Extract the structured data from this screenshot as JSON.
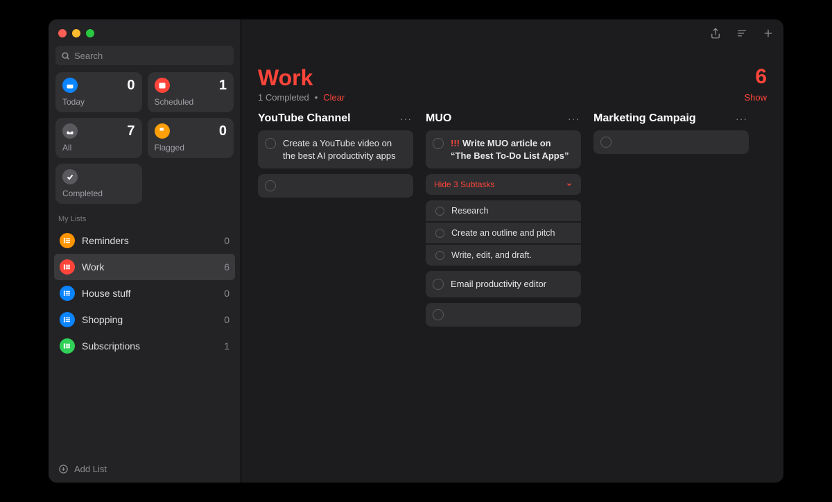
{
  "search": {
    "placeholder": "Search"
  },
  "tiles": {
    "today": {
      "label": "Today",
      "count": "0"
    },
    "scheduled": {
      "label": "Scheduled",
      "count": "1"
    },
    "all": {
      "label": "All",
      "count": "7"
    },
    "flagged": {
      "label": "Flagged",
      "count": "0"
    },
    "completed": {
      "label": "Completed"
    }
  },
  "sidebar": {
    "section_label": "My Lists",
    "items": [
      {
        "name": "Reminders",
        "count": "0"
      },
      {
        "name": "Work",
        "count": "6"
      },
      {
        "name": "House stuff",
        "count": "0"
      },
      {
        "name": "Shopping",
        "count": "0"
      },
      {
        "name": "Subscriptions",
        "count": "1"
      }
    ],
    "add_list": "Add List"
  },
  "main": {
    "title": "Work",
    "count": "6",
    "completed_text": "1 Completed",
    "bullet": "•",
    "clear": "Clear",
    "show": "Show"
  },
  "columns": [
    {
      "title": "YouTube Channel",
      "tasks": [
        {
          "text": "Create a YouTube video on the best AI productivity apps"
        }
      ]
    },
    {
      "title": "MUO",
      "tasks": [
        {
          "text": "Write MUO article on “The Best To-Do List Apps”",
          "priority": "!!!",
          "bold": true
        }
      ],
      "subtasks_header": "Hide 3 Subtasks",
      "subtasks": [
        {
          "text": "Research"
        },
        {
          "text": "Create an outline and pitch"
        },
        {
          "text": "Write, edit, and draft."
        }
      ],
      "extra_task": {
        "text": "Email productivity editor"
      }
    },
    {
      "title": "Marketing Campaig"
    }
  ]
}
